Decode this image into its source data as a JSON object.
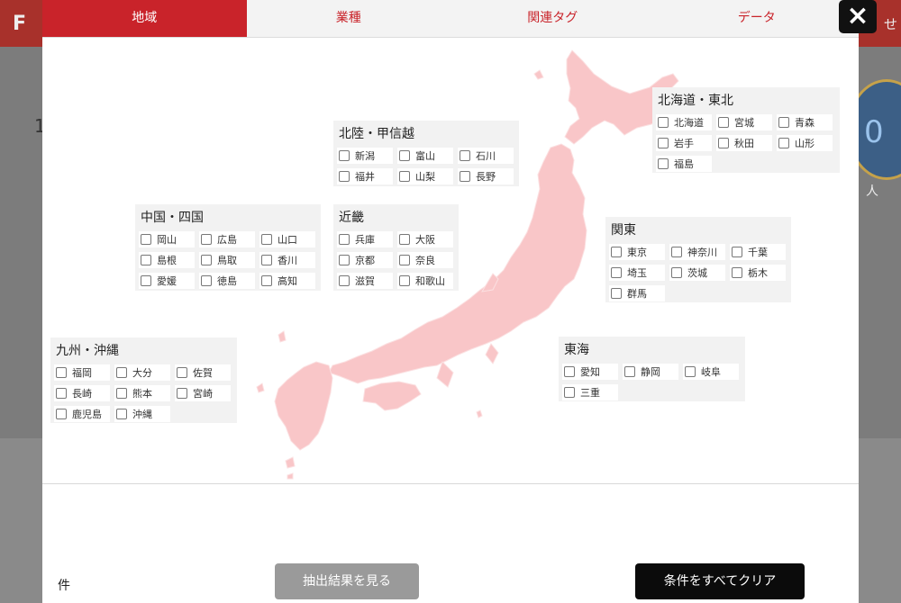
{
  "background": {
    "logo_text": "F",
    "right_text": "せ",
    "left_number": "1",
    "badge_number": "0",
    "badge_unit": "人"
  },
  "tabs": [
    {
      "label": "地域",
      "active": true
    },
    {
      "label": "業種",
      "active": false
    },
    {
      "label": "関連タグ",
      "active": false
    },
    {
      "label": "データ",
      "active": false
    }
  ],
  "close_icon": "×",
  "regions": [
    {
      "id": "hokkaido-tohoku",
      "title": "北海道・東北",
      "columns": 3,
      "prefectures": [
        "北海道",
        "宮城",
        "青森",
        "岩手",
        "秋田",
        "山形",
        "福島"
      ]
    },
    {
      "id": "hokuriku-koshinetsu",
      "title": "北陸・甲信越",
      "columns": 3,
      "prefectures": [
        "新潟",
        "富山",
        "石川",
        "福井",
        "山梨",
        "長野"
      ]
    },
    {
      "id": "kinki",
      "title": "近畿",
      "columns": 2,
      "prefectures": [
        "兵庫",
        "大阪",
        "京都",
        "奈良",
        "滋賀",
        "和歌山"
      ]
    },
    {
      "id": "chugoku-shikoku",
      "title": "中国・四国",
      "columns": 3,
      "prefectures": [
        "岡山",
        "広島",
        "山口",
        "島根",
        "鳥取",
        "香川",
        "愛媛",
        "徳島",
        "高知"
      ]
    },
    {
      "id": "kanto",
      "title": "関東",
      "columns": 3,
      "prefectures": [
        "東京",
        "神奈川",
        "千葉",
        "埼玉",
        "茨城",
        "栃木",
        "群馬"
      ]
    },
    {
      "id": "tokai",
      "title": "東海",
      "columns": 3,
      "prefectures": [
        "愛知",
        "静岡",
        "岐阜",
        "三重"
      ]
    },
    {
      "id": "kyushu-okinawa",
      "title": "九州・沖縄",
      "columns": 3,
      "prefectures": [
        "福岡",
        "大分",
        "佐賀",
        "長崎",
        "熊本",
        "宮崎",
        "鹿児島",
        "沖縄"
      ]
    }
  ],
  "footer": {
    "count_label": "件",
    "results_button": "抽出結果を見る",
    "clear_button": "条件をすべてクリア"
  },
  "colors": {
    "accent": "#c9232a",
    "map_fill": "#f9c6c8",
    "region_bg": "#f2f2f2",
    "results_button_bg": "#9a9a9a",
    "clear_button_bg": "#0b0b0b"
  }
}
